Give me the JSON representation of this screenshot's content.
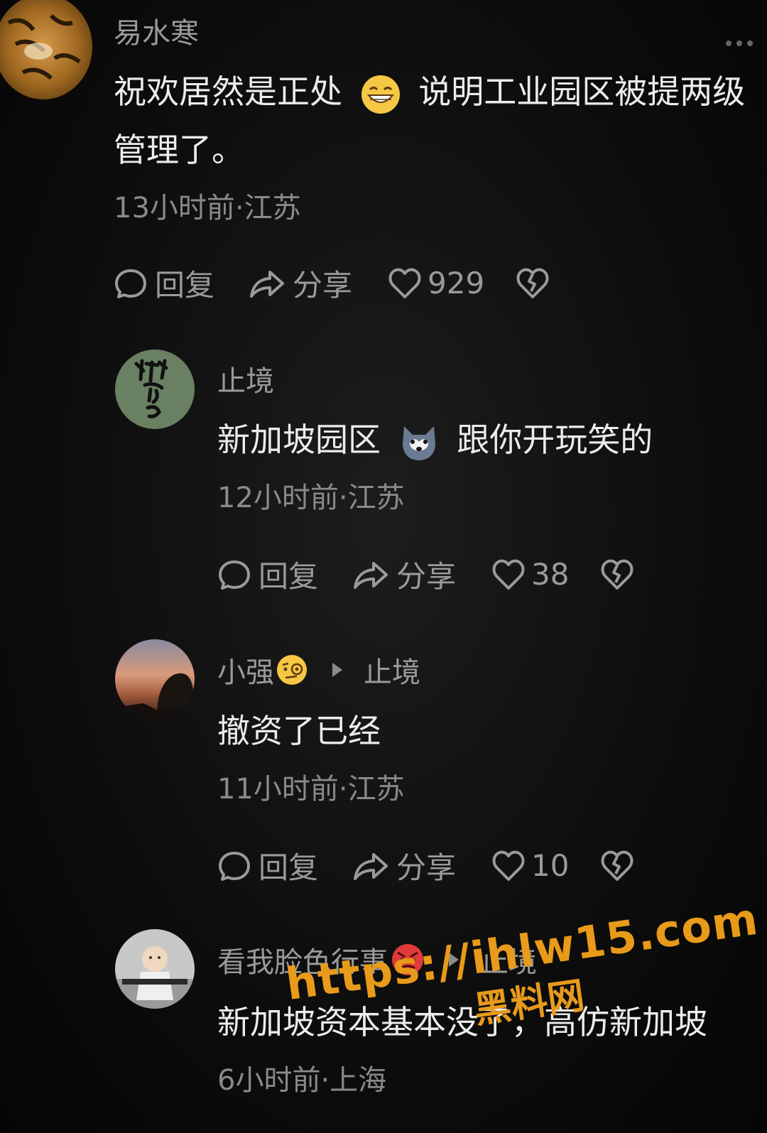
{
  "comments": [
    {
      "author": "易水寒",
      "text_part1": "祝欢居然是正处",
      "emoji": "grin-emoji",
      "text_part2": "说明工业园区被提两级",
      "text_line2": "管理了。",
      "meta": "13小时前·江苏",
      "reply_label": "回复",
      "share_label": "分享",
      "likes": "929"
    },
    {
      "author": "止境",
      "text_part1": "新加坡园区",
      "emoji": "husky-emoji",
      "text_part2": "跟你开玩笑的",
      "meta": "12小时前·江苏",
      "reply_label": "回复",
      "share_label": "分享",
      "likes": "38"
    },
    {
      "author": "小强",
      "author_emoji": "monocle-emoji",
      "reply_to": "止境",
      "text": "撤资了已经",
      "meta": "11小时前·江苏",
      "reply_label": "回复",
      "share_label": "分享",
      "likes": "10"
    },
    {
      "author": "看我脸色行事",
      "author_emoji": "angry-emoji",
      "reply_to": "止境",
      "text": "新加坡资本基本没了，高仿新加坡",
      "meta": "6小时前·上海"
    }
  ],
  "watermark": {
    "url": "https://ihlw15.com",
    "sub": "黑料网"
  },
  "colors": {
    "background": "#0e0e0e",
    "text": "#ececec",
    "muted": "#9a9a9a",
    "watermark": "#e89a1a"
  }
}
